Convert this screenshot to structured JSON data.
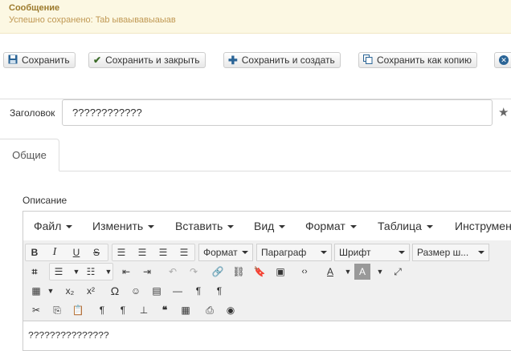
{
  "message": {
    "title": "Сообщение",
    "text": "Успешно сохранено: Tab ываывавыаыав"
  },
  "toolbar": {
    "buttons": [
      {
        "label": "Сохранить",
        "icon": "save-icon"
      },
      {
        "label": "Сохранить и закрыть",
        "icon": "check-icon"
      },
      {
        "label": "Сохранить и создать",
        "icon": "plus-icon"
      },
      {
        "label": "Сохранить как копию",
        "icon": "copy-icon"
      }
    ],
    "close_icon": "close-icon"
  },
  "form": {
    "title_label": "Заголовок",
    "title_value": "????????????",
    "tab_label": "Общие",
    "description_label": "Описание"
  },
  "editor": {
    "menu": [
      "Файл",
      "Изменить",
      "Вставить",
      "Вид",
      "Формат",
      "Таблица",
      "Инструменты"
    ],
    "dropdowns": {
      "format": "Формат",
      "paragraph": "Параграф",
      "font": "Шрифт",
      "font_size": "Размер ш..."
    },
    "content": "???????????????"
  }
}
